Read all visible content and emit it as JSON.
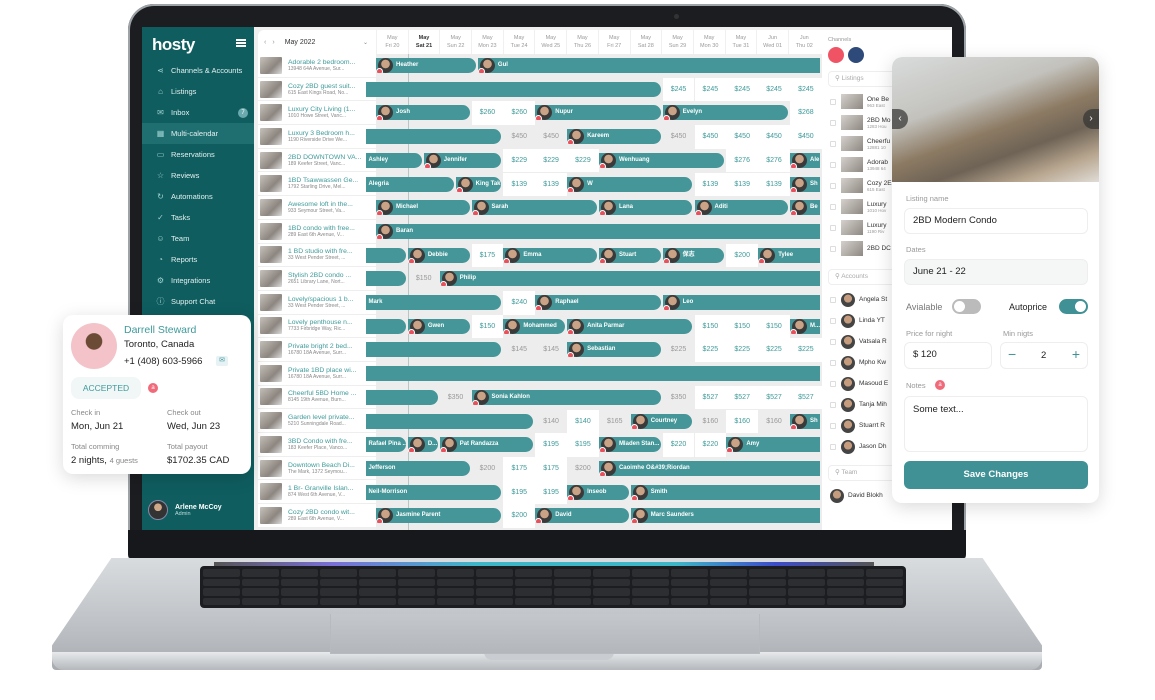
{
  "app": {
    "logo": "hosty"
  },
  "sidebar": {
    "items": [
      {
        "label": "Channels & Accounts",
        "icon": "share-icon",
        "glyph": "⋖"
      },
      {
        "label": "Listings",
        "icon": "home-icon",
        "glyph": "⌂"
      },
      {
        "label": "Inbox",
        "icon": "mail-icon",
        "glyph": "✉",
        "badge": "7"
      },
      {
        "label": "Multi-calendar",
        "icon": "calendar-icon",
        "glyph": "▦",
        "active": true
      },
      {
        "label": "Reservations",
        "icon": "briefcase-icon",
        "glyph": "▭"
      },
      {
        "label": "Reviews",
        "icon": "star-icon",
        "glyph": "☆"
      },
      {
        "label": "Automations",
        "icon": "refresh-icon",
        "glyph": "↻"
      },
      {
        "label": "Tasks",
        "icon": "check-circle-icon",
        "glyph": "✓"
      },
      {
        "label": "Team",
        "icon": "team-icon",
        "glyph": "☺"
      },
      {
        "label": "Reports",
        "icon": "pie-chart-icon",
        "glyph": "◔"
      },
      {
        "label": "Integrations",
        "icon": "gear-icon",
        "glyph": "⚙"
      },
      {
        "label": "Support Chat",
        "icon": "info-icon",
        "glyph": "ⓘ"
      }
    ],
    "user": {
      "name": "Arlene McCoy",
      "role": "Admin"
    }
  },
  "calendar": {
    "month": "May 2022",
    "dates": [
      {
        "m": "May",
        "d": "Fri 20"
      },
      {
        "m": "May",
        "d": "Sat 21",
        "today": true
      },
      {
        "m": "May",
        "d": "Sun 22"
      },
      {
        "m": "May",
        "d": "Mon 23"
      },
      {
        "m": "May",
        "d": "Tue 24"
      },
      {
        "m": "May",
        "d": "Wed 25"
      },
      {
        "m": "May",
        "d": "Thu 26"
      },
      {
        "m": "May",
        "d": "Fri 27"
      },
      {
        "m": "May",
        "d": "Sat 28"
      },
      {
        "m": "May",
        "d": "Sun 29"
      },
      {
        "m": "May",
        "d": "Mon 30"
      },
      {
        "m": "May",
        "d": "Tue 31"
      },
      {
        "m": "Jun",
        "d": "Wed 01"
      },
      {
        "m": "Jun",
        "d": "Thu 02"
      }
    ],
    "listings": [
      {
        "name": "Adorable 2 bedroom...",
        "addr": "13948 64A Avenue, Sur...",
        "bars": [
          {
            "s": 0,
            "e": 3.2,
            "g": "Heather"
          },
          {
            "s": 3.2,
            "e": 14,
            "g": "Gul"
          }
        ],
        "prices": []
      },
      {
        "name": "Cozy 2BD guest suit...",
        "addr": "615 East Kings Road, No...",
        "bars": [
          {
            "s": -1,
            "e": 9,
            "g": ""
          }
        ],
        "prices": [
          {
            "c": 9,
            "v": "$245"
          },
          {
            "c": 10,
            "v": "$245"
          },
          {
            "c": 11,
            "v": "$245"
          },
          {
            "c": 12,
            "v": "$245"
          },
          {
            "c": 13,
            "v": "$245"
          }
        ]
      },
      {
        "name": "Luxury City Living (1...",
        "addr": "1010 Howe Street, Vanc...",
        "bars": [
          {
            "s": 0,
            "e": 3,
            "g": "Josh"
          },
          {
            "s": 5,
            "e": 9,
            "g": "Nupur"
          },
          {
            "s": 9,
            "e": 13,
            "g": "Evelyn"
          }
        ],
        "prices": [
          {
            "c": 3,
            "v": "$260"
          },
          {
            "c": 4,
            "v": "$260"
          },
          {
            "c": 13,
            "v": "$268"
          }
        ]
      },
      {
        "name": "Luxury 3 Bedroom h...",
        "addr": "1190 Riverside Drive We...",
        "bars": [
          {
            "s": -1,
            "e": 4,
            "g": ""
          },
          {
            "s": 6,
            "e": 9,
            "g": "Kareem"
          }
        ],
        "prices": [
          {
            "c": 4,
            "v": "$450",
            "dim": true
          },
          {
            "c": 5,
            "v": "$450",
            "dim": true
          },
          {
            "c": 9,
            "v": "$450",
            "dim": true
          },
          {
            "c": 10,
            "v": "$450"
          },
          {
            "c": 11,
            "v": "$450"
          },
          {
            "c": 12,
            "v": "$450"
          },
          {
            "c": 13,
            "v": "$450"
          }
        ]
      },
      {
        "name": "2BD DOWNTOWN VA...",
        "addr": "189 Keefer Street, Vanc...",
        "bars": [
          {
            "s": -1,
            "e": 1.5,
            "g": "Ashley"
          },
          {
            "s": 1.5,
            "e": 4,
            "g": "Jennifer"
          },
          {
            "s": 7,
            "e": 11,
            "g": "Wenhuang"
          },
          {
            "s": 13,
            "e": 14,
            "g": "Ale"
          }
        ],
        "prices": [
          {
            "c": 4,
            "v": "$229"
          },
          {
            "c": 5,
            "v": "$229"
          },
          {
            "c": 6,
            "v": "$229"
          },
          {
            "c": 11,
            "v": "$276"
          },
          {
            "c": 12,
            "v": "$276"
          }
        ]
      },
      {
        "name": "1BD Tsawwassen Ge...",
        "addr": "1792 Starling Drive, Mel...",
        "bars": [
          {
            "s": -1,
            "e": 2.5,
            "g": "Alegria"
          },
          {
            "s": 2.5,
            "e": 4,
            "g": "King Tak"
          },
          {
            "s": 6,
            "e": 10,
            "g": "W"
          },
          {
            "s": 13,
            "e": 14,
            "g": "Sh"
          }
        ],
        "prices": [
          {
            "c": 4,
            "v": "$139"
          },
          {
            "c": 5,
            "v": "$139"
          },
          {
            "c": 10,
            "v": "$139"
          },
          {
            "c": 11,
            "v": "$139"
          },
          {
            "c": 12,
            "v": "$139"
          }
        ]
      },
      {
        "name": "Awesome loft in the...",
        "addr": "933 Seymour Street, Va...",
        "bars": [
          {
            "s": 0,
            "e": 3,
            "g": "Michael"
          },
          {
            "s": 3,
            "e": 7,
            "g": "Sarah"
          },
          {
            "s": 7,
            "e": 10,
            "g": "Lana"
          },
          {
            "s": 10,
            "e": 13,
            "g": "Aditi"
          },
          {
            "s": 13,
            "e": 14,
            "g": "Be"
          }
        ],
        "prices": []
      },
      {
        "name": "1BD condo with free...",
        "addr": "289 East 6th Avenue, V...",
        "bars": [
          {
            "s": 0,
            "e": 14,
            "g": "Baran"
          }
        ],
        "prices": []
      },
      {
        "name": "1 BD studio with fre...",
        "addr": "33 West Pender Street, ...",
        "bars": [
          {
            "s": -1,
            "e": 1,
            "g": ""
          },
          {
            "s": 1,
            "e": 3,
            "g": "Debbie"
          },
          {
            "s": 4,
            "e": 7,
            "g": "Emma"
          },
          {
            "s": 7,
            "e": 9,
            "g": "Stuart"
          },
          {
            "s": 9,
            "e": 11,
            "g": "保志"
          },
          {
            "s": 12,
            "e": 14,
            "g": "Tylee"
          }
        ],
        "prices": [
          {
            "c": 3,
            "v": "$175"
          },
          {
            "c": 11,
            "v": "$200"
          }
        ]
      },
      {
        "name": "Stylish 2BD condo ...",
        "addr": "2651 Library Lane, Nort...",
        "bars": [
          {
            "s": -1,
            "e": 1,
            "g": ""
          },
          {
            "s": 2,
            "e": 14,
            "g": "Philip"
          }
        ],
        "prices": [
          {
            "c": 1,
            "v": "$150",
            "dim": true
          }
        ]
      },
      {
        "name": "Lovely/spacious 1 b...",
        "addr": "33 West Pender Street, ...",
        "bars": [
          {
            "s": -1,
            "e": 4,
            "g": "Mark"
          },
          {
            "s": 5,
            "e": 9,
            "g": "Raphael"
          },
          {
            "s": 9,
            "e": 14,
            "g": "Leo"
          }
        ],
        "prices": [
          {
            "c": 4,
            "v": "$240"
          }
        ]
      },
      {
        "name": "Lovely penthouse n...",
        "addr": "7733 Firbridge Way, Ric...",
        "bars": [
          {
            "s": -1,
            "e": 1,
            "g": ""
          },
          {
            "s": 1,
            "e": 3,
            "g": "Gwen"
          },
          {
            "s": 4,
            "e": 6,
            "g": "Mohammed"
          },
          {
            "s": 6,
            "e": 10,
            "g": "Anita Parmar"
          },
          {
            "s": 13,
            "e": 14,
            "g": "M..."
          }
        ],
        "prices": [
          {
            "c": 3,
            "v": "$150"
          },
          {
            "c": 10,
            "v": "$150"
          },
          {
            "c": 11,
            "v": "$150"
          },
          {
            "c": 12,
            "v": "$150"
          }
        ]
      },
      {
        "name": "Private bright 2 bed...",
        "addr": "16780 18A Avenue, Surr...",
        "bars": [
          {
            "s": -1,
            "e": 4,
            "g": ""
          },
          {
            "s": 6,
            "e": 9,
            "g": "Sebastian"
          }
        ],
        "prices": [
          {
            "c": 4,
            "v": "$145",
            "dim": true
          },
          {
            "c": 5,
            "v": "$145",
            "dim": true
          },
          {
            "c": 9,
            "v": "$225",
            "dim": true
          },
          {
            "c": 10,
            "v": "$225"
          },
          {
            "c": 11,
            "v": "$225"
          },
          {
            "c": 12,
            "v": "$225"
          },
          {
            "c": 13,
            "v": "$225"
          }
        ]
      },
      {
        "name": "Private 1BD place wi...",
        "addr": "16780 18A Avenue, Surr...",
        "bars": [
          {
            "s": -1,
            "e": 14,
            "g": ""
          }
        ],
        "prices": []
      },
      {
        "name": "Cheerful 5BD Home ...",
        "addr": "8145 19th Avenue, Burn...",
        "bars": [
          {
            "s": -1,
            "e": 2,
            "g": ""
          },
          {
            "s": 3,
            "e": 9,
            "g": "Sonia Kahlon"
          }
        ],
        "prices": [
          {
            "c": 2,
            "v": "$350",
            "dim": true
          },
          {
            "c": 9,
            "v": "$350",
            "dim": true
          },
          {
            "c": 10,
            "v": "$527"
          },
          {
            "c": 11,
            "v": "$527"
          },
          {
            "c": 12,
            "v": "$527"
          },
          {
            "c": 13,
            "v": "$527"
          }
        ]
      },
      {
        "name": "Garden level private...",
        "addr": "5210 Sunningdale Road...",
        "bars": [
          {
            "s": -1,
            "e": 5,
            "g": ""
          },
          {
            "s": 8,
            "e": 10,
            "g": "Courtney"
          },
          {
            "s": 13,
            "e": 14,
            "g": "Sh"
          }
        ],
        "prices": [
          {
            "c": 5,
            "v": "$140",
            "dim": true
          },
          {
            "c": 6,
            "v": "$140"
          },
          {
            "c": 7,
            "v": "$165",
            "dim": true
          },
          {
            "c": 10,
            "v": "$160",
            "dim": true
          },
          {
            "c": 11,
            "v": "$160"
          },
          {
            "c": 12,
            "v": "$160",
            "dim": true
          }
        ]
      },
      {
        "name": "3BD Condo with fre...",
        "addr": "183 Keefer Place, Vanco...",
        "bars": [
          {
            "s": -1,
            "e": 1,
            "g": "Rafael Pina ..."
          },
          {
            "s": 1,
            "e": 2,
            "g": "D..."
          },
          {
            "s": 2,
            "e": 5,
            "g": "Pat Randazza"
          },
          {
            "s": 7,
            "e": 9,
            "g": "Mladen Stan..."
          },
          {
            "s": 11,
            "e": 14,
            "g": "Amy"
          }
        ],
        "prices": [
          {
            "c": 5,
            "v": "$195"
          },
          {
            "c": 6,
            "v": "$195"
          },
          {
            "c": 9,
            "v": "$220"
          },
          {
            "c": 10,
            "v": "$220"
          }
        ]
      },
      {
        "name": "Downtown Beach Di...",
        "addr": "The Mark, 1372 Seymou...",
        "bars": [
          {
            "s": -1,
            "e": 3,
            "g": "Jefferson"
          },
          {
            "s": 7,
            "e": 14,
            "g": "Caoimhe O&#39;Riordan"
          }
        ],
        "prices": [
          {
            "c": 3,
            "v": "$200",
            "dim": true
          },
          {
            "c": 4,
            "v": "$175"
          },
          {
            "c": 5,
            "v": "$175"
          },
          {
            "c": 6,
            "v": "$200",
            "dim": true
          }
        ]
      },
      {
        "name": "1 Br- Granville Islan...",
        "addr": "874 West 6th Avenue, V...",
        "bars": [
          {
            "s": -1,
            "e": 4,
            "g": "Neil-Morrison"
          },
          {
            "s": 6,
            "e": 8,
            "g": "Inseob"
          },
          {
            "s": 8,
            "e": 14,
            "g": "Smith"
          }
        ],
        "prices": [
          {
            "c": 4,
            "v": "$195"
          },
          {
            "c": 5,
            "v": "$195"
          }
        ]
      },
      {
        "name": "Cozy 2BD condo wit...",
        "addr": "289 East 6th Avenue, V...",
        "bars": [
          {
            "s": 0,
            "e": 4,
            "g": "Jasmine Parent"
          },
          {
            "s": 5,
            "e": 8,
            "g": "David"
          },
          {
            "s": 8,
            "e": 14,
            "g": "Marc Saunders"
          }
        ],
        "prices": [
          {
            "c": 4,
            "v": "$200"
          }
        ]
      }
    ]
  },
  "right_pane": {
    "channels_label": "Channels",
    "listings_search_placeholder": "Listings",
    "listings": [
      {
        "name": "One Be",
        "addr": "963 East"
      },
      {
        "name": "2BD Mo",
        "addr": "1283 Hou"
      },
      {
        "name": "Cheerfu",
        "addr": "12881 10"
      },
      {
        "name": "Adorab",
        "addr": "13948 64"
      },
      {
        "name": "Cozy 2E",
        "addr": "615 East"
      },
      {
        "name": "Luxury",
        "addr": "1010 Hov"
      },
      {
        "name": "Luxury",
        "addr": "1190 Riv"
      },
      {
        "name": "2BD DC",
        "addr": ""
      }
    ],
    "accounts_search_placeholder": "Accounts",
    "accounts": [
      "Angela St",
      "Linda YT",
      "Vatsala R",
      "Mpho Kw",
      "Masoud E",
      "Tanja Mih",
      "Stuarrt R",
      "Jason Dh"
    ],
    "team_search_placeholder": "Team",
    "team": [
      "David Blokh"
    ]
  },
  "guest_card": {
    "name": "Darrell Steward",
    "location": "Toronto, Canada",
    "phone": "+1 (408) 603-5966",
    "status": "ACCEPTED",
    "check_in_label": "Check in",
    "check_in": "Mon, Jun 21",
    "check_out_label": "Check out",
    "check_out": "Wed, Jun 23",
    "total_label": "Total comming",
    "nights": "2 nights,",
    "guests": "4 guests",
    "payout_label": "Total payout",
    "payout": "$1702.35 CAD"
  },
  "editor": {
    "listing_name_label": "Listing name",
    "listing_name": "2BD Modern Condo",
    "dates_label": "Dates",
    "dates": "June 21 - 22",
    "available_label": "Avialable",
    "available": false,
    "autoprice_label": "Autoprice",
    "autoprice": true,
    "price_label": "Price for night",
    "price": "$ 120",
    "min_nights_label": "Min nigts",
    "min_nights": "2",
    "notes_label": "Notes",
    "notes": "Some text...",
    "save_label": "Save Changes"
  },
  "colors": {
    "brand": "#0f5d5f",
    "accent": "#449698",
    "alert": "#e8505b"
  }
}
